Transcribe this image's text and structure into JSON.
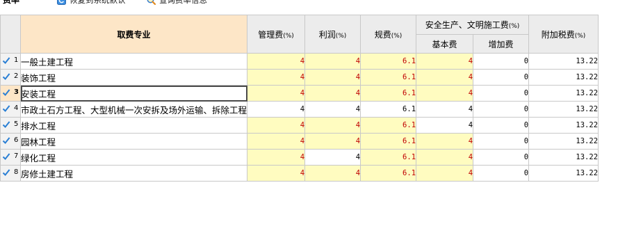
{
  "toolbar": {
    "title": "费率",
    "restore_label": "恢复到系统默认",
    "query_label": "查询费率信息"
  },
  "table": {
    "headers": {
      "category": "取费专业",
      "management": "管理费",
      "profit": "利润",
      "regulatory": "规费",
      "safety_group": "安全生产、文明施工费",
      "safety_base": "基本费",
      "safety_extra": "增加费",
      "surtax": "附加税费",
      "unit": "(%)"
    },
    "rows": [
      {
        "no": "1",
        "name": "一般土建工程",
        "management": "4",
        "profit": "4",
        "regulatory": "6.1",
        "base": "4",
        "extra": "0",
        "surtax": "13.22",
        "hl": [
          true,
          true,
          true,
          true
        ]
      },
      {
        "no": "2",
        "name": "装饰工程",
        "management": "4",
        "profit": "4",
        "regulatory": "6.1",
        "base": "4",
        "extra": "0",
        "surtax": "13.22",
        "hl": [
          true,
          true,
          true,
          true
        ]
      },
      {
        "no": "3",
        "name": "安装工程",
        "management": "4",
        "profit": "4",
        "regulatory": "6.1",
        "base": "4",
        "extra": "0",
        "surtax": "13.22",
        "hl": [
          true,
          true,
          true,
          true
        ]
      },
      {
        "no": "4",
        "name": "市政土石方工程、大型机械一次安拆及场外运输、拆除工程",
        "management": "4",
        "profit": "4",
        "regulatory": "6.1",
        "base": "4",
        "extra": "0",
        "surtax": "13.22",
        "hl": [
          false,
          false,
          false,
          false
        ]
      },
      {
        "no": "5",
        "name": "排水工程",
        "management": "4",
        "profit": "4",
        "regulatory": "6.1",
        "base": "4",
        "extra": "0",
        "surtax": "13.22",
        "hl": [
          true,
          true,
          true,
          false
        ]
      },
      {
        "no": "6",
        "name": "园林工程",
        "management": "4",
        "profit": "4",
        "regulatory": "6.1",
        "base": "4",
        "extra": "0",
        "surtax": "13.22",
        "hl": [
          true,
          true,
          true,
          true
        ]
      },
      {
        "no": "7",
        "name": "绿化工程",
        "management": "4",
        "profit": "4",
        "regulatory": "6.1",
        "base": "4",
        "extra": "0",
        "surtax": "13.22",
        "hl": [
          true,
          false,
          true,
          true
        ]
      },
      {
        "no": "8",
        "name": "房修土建工程",
        "management": "4",
        "profit": "4",
        "regulatory": "6.1",
        "base": "4",
        "extra": "0",
        "surtax": "13.22",
        "hl": [
          true,
          true,
          true,
          true
        ]
      }
    ],
    "current_row": "3"
  },
  "colors": {
    "header_highlight": "#fde6c7",
    "cell_highlight": "#fffcc0",
    "highlight_text": "#c00000",
    "check": "#2a7fd4"
  }
}
